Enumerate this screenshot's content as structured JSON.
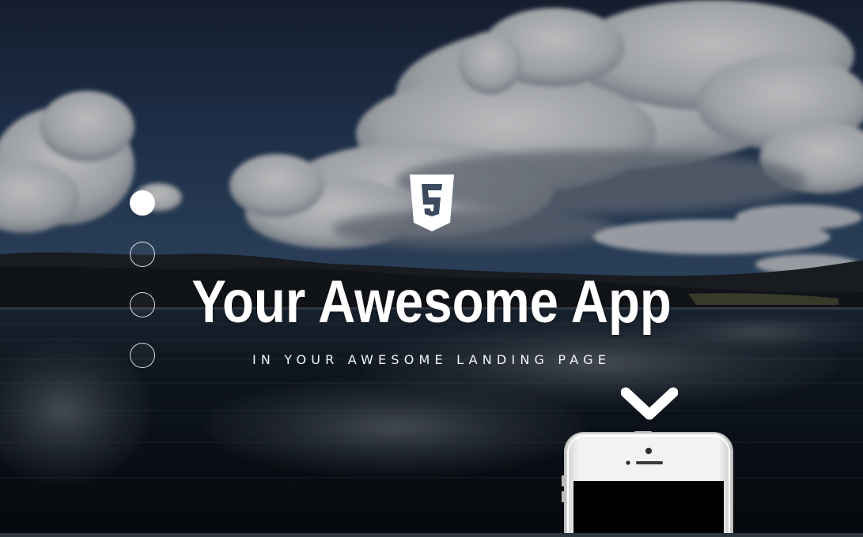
{
  "hero": {
    "title": "Your Awesome App",
    "subtitle": "IN YOUR AWESOME LANDING PAGE",
    "logo_icon": "html5-icon",
    "scroll_icon": "chevron-down-icon",
    "device_icon": "smartphone-icon"
  },
  "pagination": {
    "count": 4,
    "active_index": 0
  },
  "colors": {
    "text": "#ffffff",
    "sky_dark": "#1c2a40",
    "water_dark": "#0b1017",
    "phone_body": "#e9e9e9",
    "phone_screen": "#000000"
  }
}
